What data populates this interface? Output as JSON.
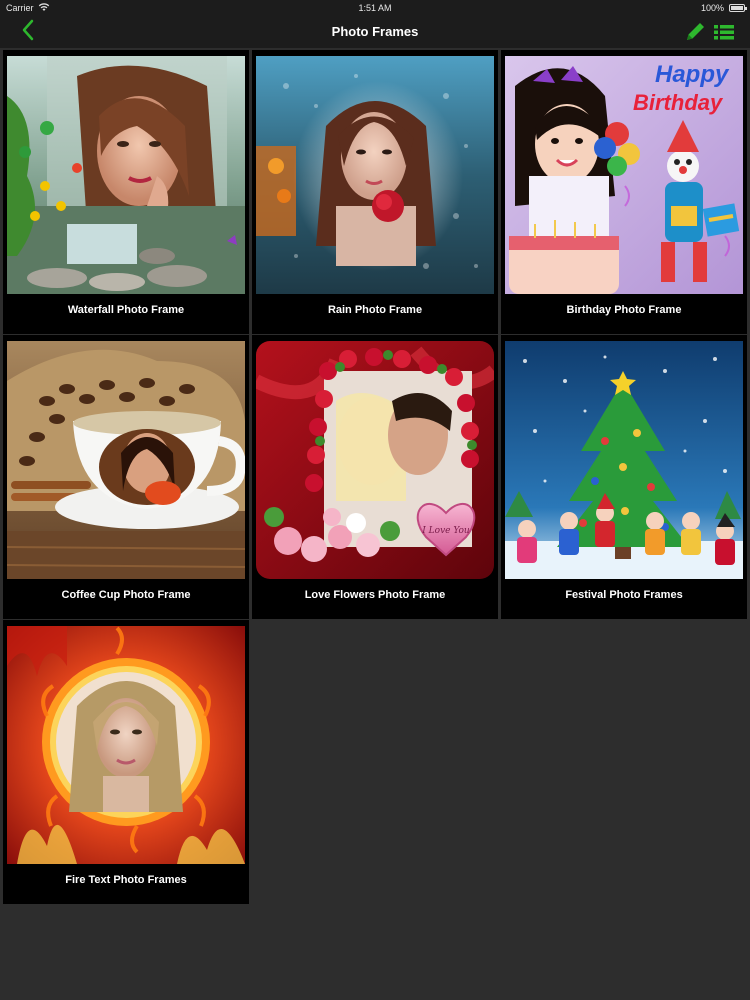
{
  "status_bar": {
    "carrier": "Carrier",
    "time": "1:51 AM",
    "battery": "100%"
  },
  "nav": {
    "title": "Photo Frames",
    "accent_color": "#2eb82e"
  },
  "frames": [
    {
      "label": "Waterfall Photo Frame"
    },
    {
      "label": "Rain Photo Frame"
    },
    {
      "label": "Birthday Photo Frame",
      "overlay_text_1": "Happy",
      "overlay_text_2": "Birthday"
    },
    {
      "label": "Coffee Cup Photo Frame"
    },
    {
      "label": "Love Flowers Photo Frame",
      "overlay_text": "I Love You"
    },
    {
      "label": "Festival Photo Frames"
    },
    {
      "label": "Fire Text Photo Frames"
    }
  ]
}
